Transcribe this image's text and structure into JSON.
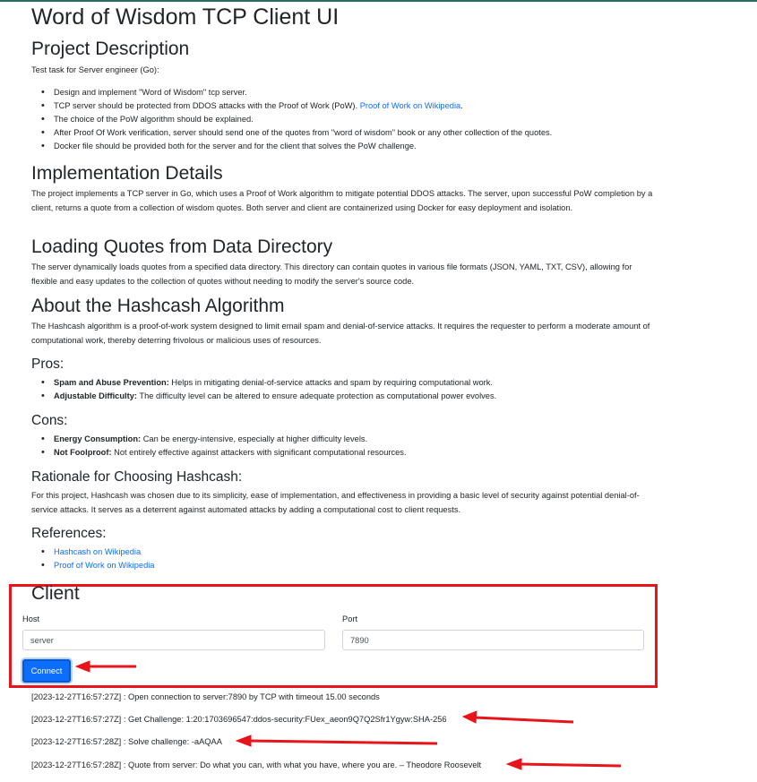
{
  "title": "Word of Wisdom TCP Client UI",
  "project": {
    "heading": "Project Description",
    "intro": "Test task for Server engineer (Go):",
    "items": [
      {
        "text": "Design and implement \"Word of Wisdom\" tcp server.",
        "link": ""
      },
      {
        "text": "TCP server should be protected from DDOS attacks with the Proof of Work (PoW). ",
        "link": "Proof of Work on Wikipedia",
        "after": "."
      },
      {
        "text": "The choice of the PoW algorithm should be explained.",
        "link": ""
      },
      {
        "text": "After Proof Of Work verification, server should send one of the quotes from \"word of wisdom\" book or any other collection of the quotes.",
        "link": ""
      },
      {
        "text": "Docker file should be provided both for the server and for the client that solves the PoW challenge.",
        "link": ""
      }
    ]
  },
  "implementation": {
    "heading": "Implementation Details",
    "text": "The project implements a TCP server in Go, which uses a Proof of Work algorithm to mitigate potential DDOS attacks. The server, upon successful PoW completion by a client, returns a quote from a collection of wisdom quotes. Both server and client are containerized using Docker for easy deployment and isolation."
  },
  "loading": {
    "heading": "Loading Quotes from Data Directory",
    "text": "The server dynamically loads quotes from a specified data directory. This directory can contain quotes in various file formats (JSON, YAML, TXT, CSV), allowing for flexible and easy updates to the collection of quotes without needing to modify the server's source code."
  },
  "hashcash": {
    "heading": "About the Hashcash Algorithm",
    "text": "The Hashcash algorithm is a proof-of-work system designed to limit email spam and denial-of-service attacks. It requires the requester to perform a moderate amount of computational work, thereby deterring frivolous or malicious uses of resources."
  },
  "pros": {
    "heading": "Pros:",
    "items": [
      {
        "bold": "Spam and Abuse Prevention:",
        "text": " Helps in mitigating denial-of-service attacks and spam by requiring computational work."
      },
      {
        "bold": "Adjustable Difficulty:",
        "text": " The difficulty level can be altered to ensure adequate protection as computational power evolves."
      }
    ]
  },
  "cons": {
    "heading": "Cons:",
    "items": [
      {
        "bold": "Energy Consumption:",
        "text": " Can be energy-intensive, especially at higher difficulty levels."
      },
      {
        "bold": "Not Foolproof:",
        "text": " Not entirely effective against attackers with significant computational resources."
      }
    ]
  },
  "rationale": {
    "heading": "Rationale for Choosing Hashcash:",
    "text": "For this project, Hashcash was chosen due to its simplicity, ease of implementation, and effectiveness in providing a basic level of security against potential denial-of-service attacks. It serves as a deterrent against automated attacks by adding a computational cost to client requests."
  },
  "references": {
    "heading": "References:",
    "links": [
      "Hashcash on Wikipedia",
      "Proof of Work on Wikipedia"
    ]
  },
  "client": {
    "heading": "Client",
    "host_label": "Host",
    "host_value": "server",
    "port_label": "Port",
    "port_value": "7890",
    "connect_label": "Connect"
  },
  "log": [
    "[2023-12-27T16:57:27Z] : Open connection to server:7890 by TCP with timeout 15.00 seconds",
    "[2023-12-27T16:57:27Z] : Get Challenge: 1:20:1703696547:ddos-security:FUex_aeon9Q7Q2Sfr1Ygyw:SHA-256",
    "[2023-12-27T16:57:28Z] : Solve challenge: -aAQAA",
    "[2023-12-27T16:57:28Z] : Quote from server: Do what you can, with what you have, where you are. – Theodore Roosevelt"
  ],
  "colors": {
    "accent": "#0d6efd",
    "annotation_red": "#e8141b",
    "text": "#212529"
  }
}
